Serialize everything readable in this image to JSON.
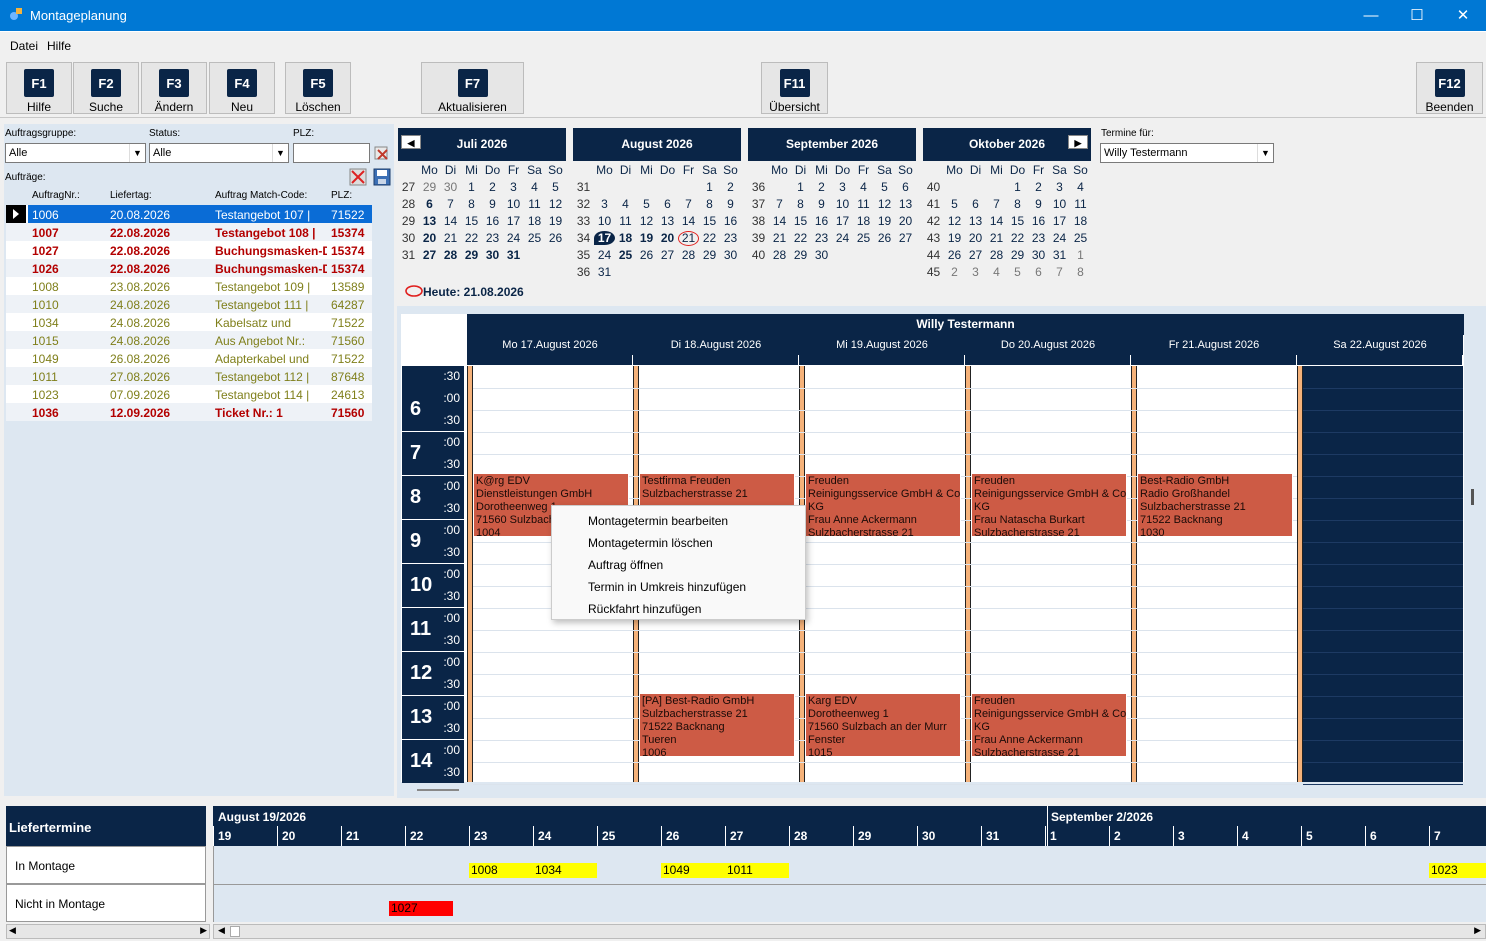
{
  "window": {
    "title": "Montageplanung"
  },
  "menu": [
    "Datei",
    "Hilfe"
  ],
  "toolbar": [
    {
      "key": "F1",
      "label": "Hilfe"
    },
    {
      "key": "F2",
      "label": "Suche"
    },
    {
      "key": "F3",
      "label": "Ändern"
    },
    {
      "key": "F4",
      "label": "Neu"
    },
    {
      "key": "F5",
      "label": "Löschen"
    },
    {
      "key": "F7",
      "label": "Aktualisieren"
    },
    {
      "key": "F11",
      "label": "Übersicht"
    },
    {
      "key": "F12",
      "label": "Beenden"
    }
  ],
  "filters": {
    "group_label": "Auftragsgruppe:",
    "group_value": "Alle",
    "status_label": "Status:",
    "status_value": "Alle",
    "plz_label": "PLZ:",
    "plz_value": "",
    "orders_label": "Aufträge:"
  },
  "orders": {
    "headers": [
      "AuftragNr.:",
      "Liefertag:",
      "Auftrag Match-Code:",
      "PLZ:"
    ],
    "rows": [
      {
        "nr": "1006",
        "date": "20.08.2026",
        "code": "Testangebot 107 |",
        "plz": "71522",
        "style": "selected"
      },
      {
        "nr": "1007",
        "date": "22.08.2026",
        "code": "Testangebot 108 |",
        "plz": "15374",
        "style": "red"
      },
      {
        "nr": "1027",
        "date": "22.08.2026",
        "code": "Buchungsmasken-De",
        "plz": "15374",
        "style": "red"
      },
      {
        "nr": "1026",
        "date": "22.08.2026",
        "code": "Buchungsmasken-De",
        "plz": "15374",
        "style": "red"
      },
      {
        "nr": "1008",
        "date": "23.08.2026",
        "code": "Testangebot 109 |",
        "plz": "13589",
        "style": "olive"
      },
      {
        "nr": "1010",
        "date": "24.08.2026",
        "code": "Testangebot 111 |",
        "plz": "64287",
        "style": "olive"
      },
      {
        "nr": "1034",
        "date": "24.08.2026",
        "code": "Kabelsatz und",
        "plz": "71522",
        "style": "olive"
      },
      {
        "nr": "1015",
        "date": "24.08.2026",
        "code": "Aus Angebot Nr.:",
        "plz": "71560",
        "style": "olive"
      },
      {
        "nr": "1049",
        "date": "26.08.2026",
        "code": "Adapterkabel und",
        "plz": "71522",
        "style": "olive"
      },
      {
        "nr": "1011",
        "date": "27.08.2026",
        "code": "Testangebot 112 |",
        "plz": "87648",
        "style": "olive"
      },
      {
        "nr": "1023",
        "date": "07.09.2026",
        "code": "Testangebot 114 |",
        "plz": "24613",
        "style": "olive"
      },
      {
        "nr": "1036",
        "date": "12.09.2026",
        "code": "Ticket Nr.: 1",
        "plz": "71560",
        "style": "red"
      }
    ]
  },
  "calendars": [
    {
      "title": "Juli 2026",
      "rows": [
        [
          "27",
          "29",
          "30",
          "1",
          "2",
          "3",
          "4",
          "5"
        ],
        [
          "28",
          "6",
          "7",
          "8",
          "9",
          "10",
          "11",
          "12"
        ],
        [
          "29",
          "13",
          "14",
          "15",
          "16",
          "17",
          "18",
          "19"
        ],
        [
          "30",
          "20",
          "21",
          "22",
          "23",
          "24",
          "25",
          "26"
        ],
        [
          "31",
          "27",
          "28",
          "29",
          "30",
          "31",
          "",
          ""
        ]
      ]
    },
    {
      "title": "August 2026",
      "rows": [
        [
          "31",
          "",
          "",
          "",
          "",
          "",
          "1",
          "2"
        ],
        [
          "32",
          "3",
          "4",
          "5",
          "6",
          "7",
          "8",
          "9"
        ],
        [
          "33",
          "10",
          "11",
          "12",
          "13",
          "14",
          "15",
          "16"
        ],
        [
          "34",
          "17",
          "18",
          "19",
          "20",
          "21",
          "22",
          "23"
        ],
        [
          "35",
          "24",
          "25",
          "26",
          "27",
          "28",
          "29",
          "30"
        ],
        [
          "36",
          "31",
          "",
          "",
          "",
          "",
          "",
          ""
        ]
      ]
    },
    {
      "title": "September 2026",
      "rows": [
        [
          "36",
          "",
          "1",
          "2",
          "3",
          "4",
          "5",
          "6"
        ],
        [
          "37",
          "7",
          "8",
          "9",
          "10",
          "11",
          "12",
          "13"
        ],
        [
          "38",
          "14",
          "15",
          "16",
          "17",
          "18",
          "19",
          "20"
        ],
        [
          "39",
          "21",
          "22",
          "23",
          "24",
          "25",
          "26",
          "27"
        ],
        [
          "40",
          "28",
          "29",
          "30",
          "",
          "",
          "",
          ""
        ]
      ]
    },
    {
      "title": "Oktober 2026",
      "rows": [
        [
          "40",
          "",
          "",
          "",
          "1",
          "2",
          "3",
          "4"
        ],
        [
          "41",
          "5",
          "6",
          "7",
          "8",
          "9",
          "10",
          "11"
        ],
        [
          "42",
          "12",
          "13",
          "14",
          "15",
          "16",
          "17",
          "18"
        ],
        [
          "43",
          "19",
          "20",
          "21",
          "22",
          "23",
          "24",
          "25"
        ],
        [
          "44",
          "26",
          "27",
          "28",
          "29",
          "30",
          "31",
          "1"
        ],
        [
          "45",
          "2",
          "3",
          "4",
          "5",
          "6",
          "7",
          "8"
        ]
      ]
    }
  ],
  "weekdays": [
    "Mo",
    "Di",
    "Mi",
    "Do",
    "Fr",
    "Sa",
    "So"
  ],
  "today_label": "Heute: 21.08.2026",
  "termine_fuer": {
    "label": "Termine für:",
    "value": "Willy Testermann"
  },
  "schedule": {
    "person": "Willy Testermann",
    "days": [
      "Mo 17.August 2026",
      "Di 18.August 2026",
      "Mi 19.August 2026",
      "Do 20.August 2026",
      "Fr 21.August 2026",
      "Sa 22.August 2026"
    ],
    "hours": [
      "6",
      "7",
      "8",
      "9",
      "10",
      "11",
      "12",
      "13",
      "14"
    ],
    "appointments": [
      {
        "day": 0,
        "start": 8,
        "text": "K@rg EDV\nDienstleistungen GmbH\nDorotheenweg 1\n71560 Sulzbach\n1004"
      },
      {
        "day": 1,
        "start": 8,
        "text": "Testfirma Freuden\nSulzbacherstrasse 21"
      },
      {
        "day": 2,
        "start": 8,
        "text": "Freuden\nReinigungsservice GmbH & Co.\nKG\nFrau Anne Ackermann\nSulzbacherstrasse 21"
      },
      {
        "day": 3,
        "start": 8,
        "text": "Freuden\nReinigungsservice GmbH & Co.\nKG\nFrau Natascha Burkart\nSulzbacherstrasse 21"
      },
      {
        "day": 4,
        "start": 8,
        "text": "Best-Radio GmbH\nRadio Großhandel\nSulzbacherstrasse 21\n71522 Backnang\n1030"
      },
      {
        "day": 1,
        "start": 13,
        "text": "[PA] Best-Radio GmbH\nSulzbacherstrasse 21\n71522 Backnang\nTueren\n1006"
      },
      {
        "day": 2,
        "start": 13,
        "text": "Karg EDV\nDorotheenweg 1\n71560 Sulzbach an der Murr\nFenster\n1015"
      },
      {
        "day": 3,
        "start": 13,
        "text": "Freuden\nReinigungsservice GmbH & Co.\nKG\nFrau Anne Ackermann\nSulzbacherstrasse 21"
      }
    ]
  },
  "context_menu": [
    "Montagetermin bearbeiten",
    "Montagetermin löschen",
    "Auftrag öffnen",
    "Termin in Umkreis hinzufügen",
    "Rückfahrt hinzufügen"
  ],
  "timeline": {
    "title": "Liefertermine",
    "months": [
      "August 19/2026",
      "September 2/2026"
    ],
    "days": [
      "19",
      "20",
      "21",
      "22",
      "23",
      "24",
      "25",
      "26",
      "27",
      "28",
      "29",
      "30",
      "31",
      "1",
      "2",
      "3",
      "4",
      "5",
      "6",
      "7"
    ],
    "row_labels": [
      "In Montage",
      "Nicht in Montage"
    ],
    "in_montage": [
      {
        "id": "1008",
        "col": 4
      },
      {
        "id": "1034",
        "col": 5
      },
      {
        "id": "1049",
        "col": 7
      },
      {
        "id": "1011",
        "col": 8
      },
      {
        "id": "1023",
        "col": 19
      }
    ],
    "nicht_in_montage": [
      {
        "id": "1027",
        "col": 3
      }
    ],
    "colors": {
      "in_montage": "#ffff00",
      "nicht": "#ff0000"
    }
  }
}
